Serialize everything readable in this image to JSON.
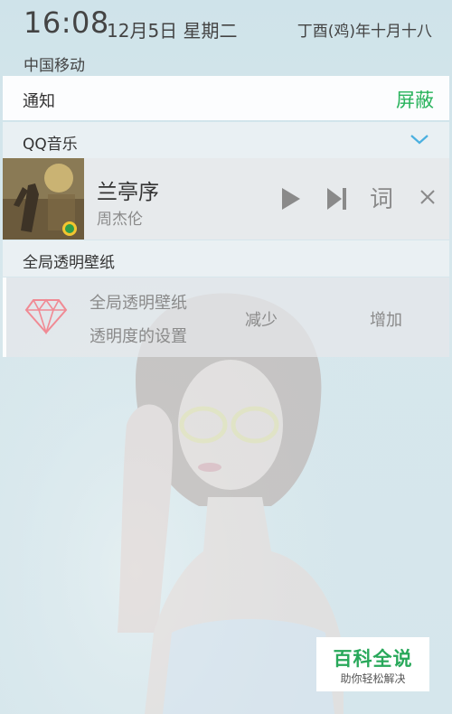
{
  "status_bar": {
    "time": "16:08",
    "date": "12月5日  星期二",
    "lunar_date": "丁酉(鸡)年十月十八",
    "carrier": "中国移动"
  },
  "notification_header": {
    "title": "通知",
    "block_label": "屏蔽",
    "block_color": "#29b35c"
  },
  "music_app": {
    "app_name": "QQ音乐",
    "expand_icon": "chevron-down-icon",
    "accent_color": "#4ab0e0",
    "song_title": "兰亭序",
    "artist": "周杰伦",
    "lyric_label": "词",
    "controls": [
      "play-icon",
      "next-track-icon",
      "close-icon"
    ]
  },
  "wallpaper_app": {
    "app_name": "全局透明壁纸",
    "icon": "diamond-icon",
    "icon_color": "#f08a94",
    "line1": "全局透明壁纸",
    "line2": "透明度的设置",
    "decrease_label": "减少",
    "increase_label": "增加"
  },
  "watermark": {
    "title": "百科全说",
    "subtitle": "助你轻松解决"
  }
}
